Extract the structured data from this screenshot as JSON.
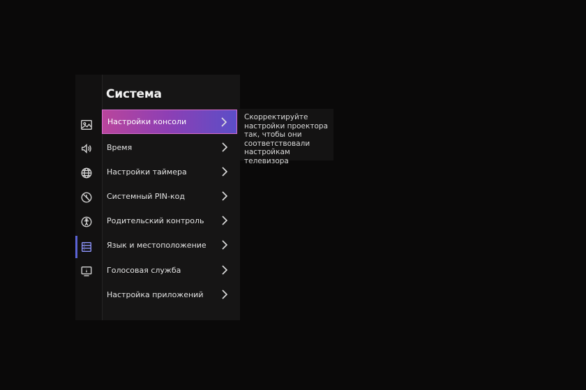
{
  "panel": {
    "title": "Система"
  },
  "sidebar": {
    "icons": [
      {
        "name": "picture-icon"
      },
      {
        "name": "sound-icon"
      },
      {
        "name": "network-icon"
      },
      {
        "name": "blocked-timer-icon"
      },
      {
        "name": "accessibility-icon"
      },
      {
        "name": "system-icon",
        "active": true
      },
      {
        "name": "info-icon"
      }
    ]
  },
  "menu": {
    "items": [
      {
        "label": "Настройки консоли",
        "selected": true
      },
      {
        "label": "Время"
      },
      {
        "label": "Настройки таймера"
      },
      {
        "label": "Системный PIN-код"
      },
      {
        "label": "Родительский контроль"
      },
      {
        "label": "Язык и местоположение"
      },
      {
        "label": "Голосовая служба"
      },
      {
        "label": "Настройка приложений"
      }
    ]
  },
  "description": {
    "text": "Скорректируйте настройки проектора так, чтобы они соответствовали настройкам телевизора"
  },
  "colors": {
    "background": "#0a0909",
    "panel": "#161515",
    "accent": "#5b63d6",
    "selection_gradient_start": "#b9459c",
    "selection_gradient_end": "#5b4ec7"
  }
}
